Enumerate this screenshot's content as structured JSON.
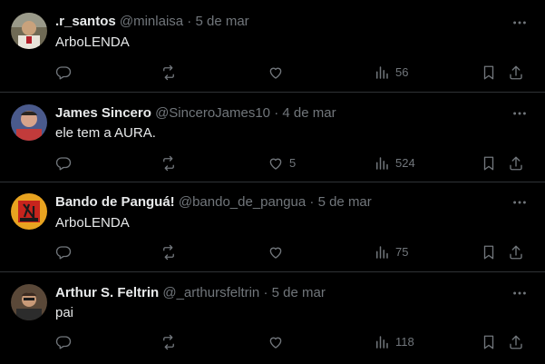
{
  "replies": [
    {
      "name": ".r_santos",
      "handle": "@minlaisa",
      "separator": "·",
      "date": "5 de mar",
      "text": "ArboLENDA",
      "likes": "",
      "views": "56"
    },
    {
      "name": "James Sincero",
      "handle": "@SinceroJames10",
      "separator": "·",
      "date": "4 de mar",
      "text": "ele tem a AURA.",
      "likes": "5",
      "views": "524"
    },
    {
      "name": "Bando de Panguá!",
      "handle": "@bando_de_pangua",
      "separator": "·",
      "date": "5 de mar",
      "text": "ArboLENDA",
      "likes": "",
      "views": "75"
    },
    {
      "name": "Arthur S. Feltrin",
      "handle": "@_arthursfeltrin",
      "separator": "·",
      "date": "5 de mar",
      "text": "pai",
      "likes": "",
      "views": "118"
    }
  ],
  "icons": {
    "more": "more-horizontal-icon",
    "reply": "reply-bubble-icon",
    "repost": "repost-arrows-icon",
    "like": "heart-icon",
    "views": "bar-chart-icon",
    "bookmark": "bookmark-icon",
    "share": "share-upload-icon"
  },
  "colors": {
    "background": "#000000",
    "text": "#e7e9ea",
    "muted": "#71767b",
    "divider": "#2f3336"
  }
}
